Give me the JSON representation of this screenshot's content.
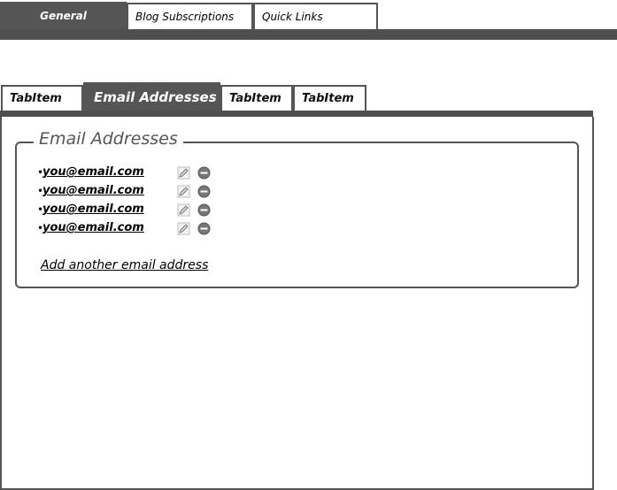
{
  "top_tabs": [
    "General",
    "Blog Subscriptions",
    "Quick Links"
  ],
  "sub_tabs": [
    "TabItem",
    "Email Addresses",
    "TabItem",
    "TabItem"
  ],
  "group": {
    "title": "Email Addresses",
    "emails": [
      "you@email.com",
      "you@email.com",
      "you@email.com",
      "you@email.com"
    ],
    "add_link": "Add another email address"
  },
  "icons": {
    "edit": "pencil-icon",
    "remove": "minus-circle-icon"
  }
}
